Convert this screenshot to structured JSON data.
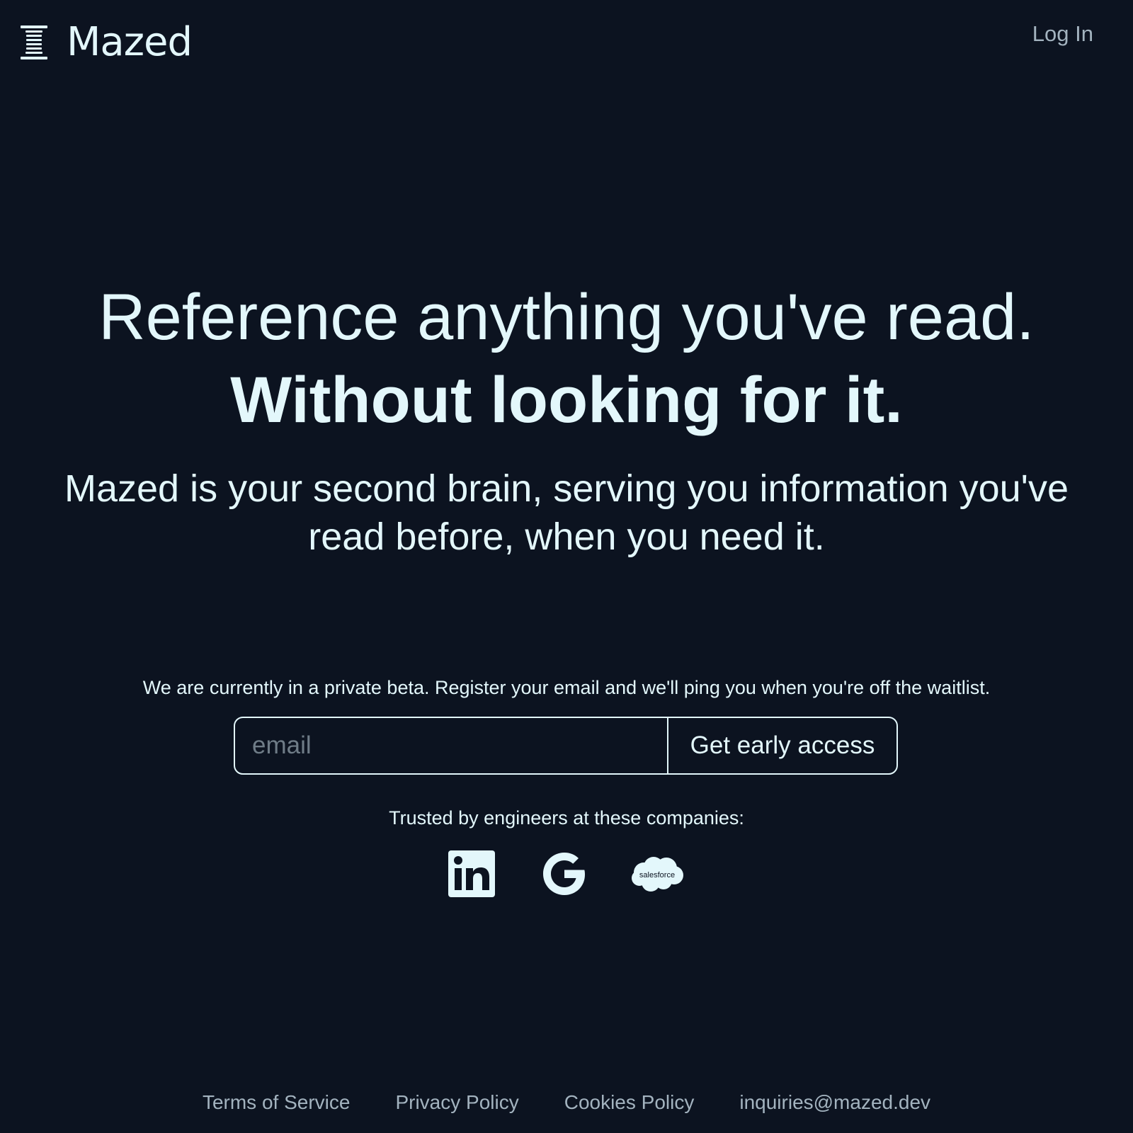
{
  "header": {
    "brand_name": "Mazed",
    "login_label": "Log In"
  },
  "hero": {
    "headline_line1": "Reference anything you've read.",
    "headline_line2": "Without looking for it.",
    "subheadline": "Mazed is your second brain, serving you information you've read before, when you need it."
  },
  "signup": {
    "beta_text": "We are currently in a private beta. Register your email and we'll ping you when you're off the waitlist.",
    "email_placeholder": "email",
    "email_value": "",
    "button_label": "Get early access"
  },
  "trusted": {
    "label": "Trusted by engineers at these companies:",
    "companies": [
      {
        "icon": "linkedin-logo"
      },
      {
        "icon": "google-logo"
      },
      {
        "icon": "salesforce-logo",
        "text": "salesforce"
      }
    ]
  },
  "footer": {
    "links": [
      {
        "label": "Terms of Service"
      },
      {
        "label": "Privacy Policy"
      },
      {
        "label": "Cookies Policy"
      },
      {
        "label": "inquiries@mazed.dev"
      }
    ]
  },
  "colors": {
    "background": "#0c1320",
    "foreground": "#e3f7fb",
    "muted": "#a3b3bf",
    "placeholder": "#6f7c87"
  }
}
